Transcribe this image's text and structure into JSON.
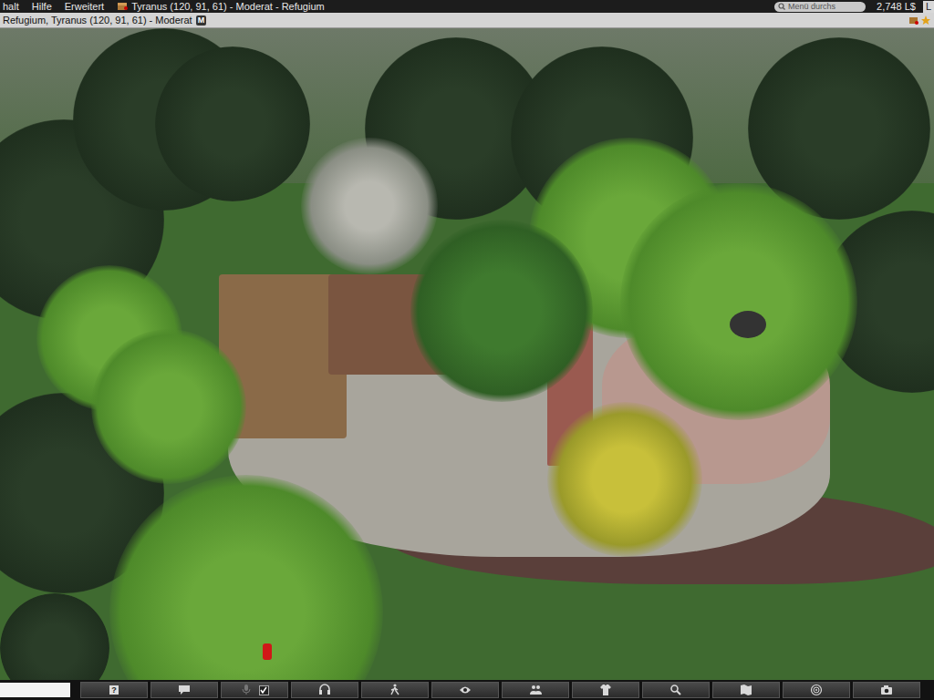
{
  "menu": {
    "items": [
      "halt",
      "Hilfe",
      "Erweitert"
    ]
  },
  "location": {
    "title": "Tyranus (120, 91, 61) - Moderat - Refugium"
  },
  "search": {
    "placeholder": "Menü durchs"
  },
  "balance": "2,748 L$",
  "shop": "L",
  "nav_bar": {
    "location": "Refugium, Tyranus (120, 91, 61) - Moderat",
    "badge": "M"
  },
  "toolbar": {
    "help": "?",
    "voice_enabled": true
  }
}
